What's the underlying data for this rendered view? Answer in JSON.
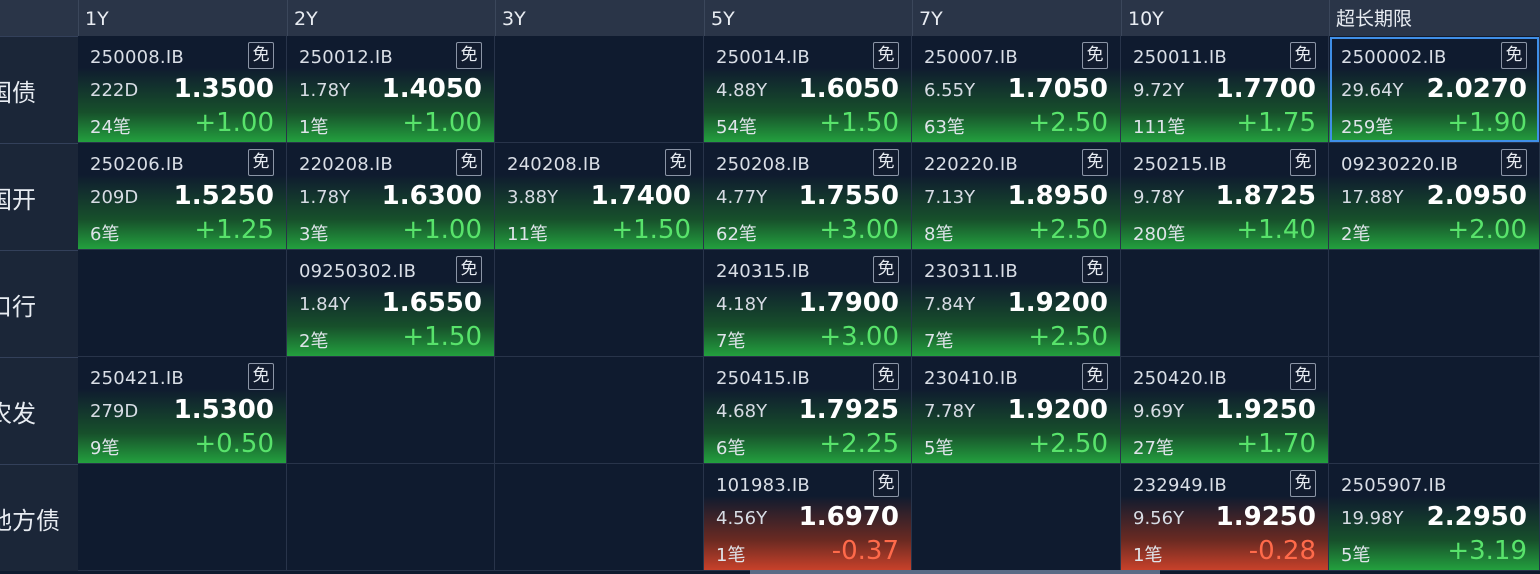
{
  "columns": [
    "1Y",
    "2Y",
    "3Y",
    "5Y",
    "7Y",
    "10Y",
    "超长期限"
  ],
  "rows": [
    {
      "label": "国债",
      "cells": [
        {
          "code": "250008.IB",
          "badge": "免",
          "term": "222D",
          "yield": "1.3500",
          "count": "24笔",
          "change": "+1.00",
          "trend": "up"
        },
        {
          "code": "250012.IB",
          "badge": "免",
          "term": "1.78Y",
          "yield": "1.4050",
          "count": "1笔",
          "change": "+1.00",
          "trend": "up"
        },
        null,
        {
          "code": "250014.IB",
          "badge": "免",
          "term": "4.88Y",
          "yield": "1.6050",
          "count": "54笔",
          "change": "+1.50",
          "trend": "up"
        },
        {
          "code": "250007.IB",
          "badge": "免",
          "term": "6.55Y",
          "yield": "1.7050",
          "count": "63笔",
          "change": "+2.50",
          "trend": "up"
        },
        {
          "code": "250011.IB",
          "badge": "免",
          "term": "9.72Y",
          "yield": "1.7700",
          "count": "111笔",
          "change": "+1.75",
          "trend": "up"
        },
        {
          "code": "2500002.IB",
          "badge": "免",
          "term": "29.64Y",
          "yield": "2.0270",
          "count": "259笔",
          "change": "+1.90",
          "trend": "up",
          "selected": true
        }
      ]
    },
    {
      "label": "国开",
      "cells": [
        {
          "code": "250206.IB",
          "badge": "免",
          "term": "209D",
          "yield": "1.5250",
          "count": "6笔",
          "change": "+1.25",
          "trend": "up"
        },
        {
          "code": "220208.IB",
          "badge": "免",
          "term": "1.78Y",
          "yield": "1.6300",
          "count": "3笔",
          "change": "+1.00",
          "trend": "up"
        },
        {
          "code": "240208.IB",
          "badge": "免",
          "term": "3.88Y",
          "yield": "1.7400",
          "count": "11笔",
          "change": "+1.50",
          "trend": "up"
        },
        {
          "code": "250208.IB",
          "badge": "免",
          "term": "4.77Y",
          "yield": "1.7550",
          "count": "62笔",
          "change": "+3.00",
          "trend": "up"
        },
        {
          "code": "220220.IB",
          "badge": "免",
          "term": "7.13Y",
          "yield": "1.8950",
          "count": "8笔",
          "change": "+2.50",
          "trend": "up"
        },
        {
          "code": "250215.IB",
          "badge": "免",
          "term": "9.78Y",
          "yield": "1.8725",
          "count": "280笔",
          "change": "+1.40",
          "trend": "up"
        },
        {
          "code": "09230220.IB",
          "badge": "免",
          "term": "17.88Y",
          "yield": "2.0950",
          "count": "2笔",
          "change": "+2.00",
          "trend": "up"
        }
      ]
    },
    {
      "label": "口行",
      "cells": [
        null,
        {
          "code": "09250302.IB",
          "badge": "免",
          "term": "1.84Y",
          "yield": "1.6550",
          "count": "2笔",
          "change": "+1.50",
          "trend": "up"
        },
        null,
        {
          "code": "240315.IB",
          "badge": "免",
          "term": "4.18Y",
          "yield": "1.7900",
          "count": "7笔",
          "change": "+3.00",
          "trend": "up"
        },
        {
          "code": "230311.IB",
          "badge": "免",
          "term": "7.84Y",
          "yield": "1.9200",
          "count": "7笔",
          "change": "+2.50",
          "trend": "up"
        },
        null,
        null
      ]
    },
    {
      "label": "农发",
      "cells": [
        {
          "code": "250421.IB",
          "badge": "免",
          "term": "279D",
          "yield": "1.5300",
          "count": "9笔",
          "change": "+0.50",
          "trend": "up"
        },
        null,
        null,
        {
          "code": "250415.IB",
          "badge": "免",
          "term": "4.68Y",
          "yield": "1.7925",
          "count": "6笔",
          "change": "+2.25",
          "trend": "up"
        },
        {
          "code": "230410.IB",
          "badge": "免",
          "term": "7.78Y",
          "yield": "1.9200",
          "count": "5笔",
          "change": "+2.50",
          "trend": "up"
        },
        {
          "code": "250420.IB",
          "badge": "免",
          "term": "9.69Y",
          "yield": "1.9250",
          "count": "27笔",
          "change": "+1.70",
          "trend": "up"
        },
        null
      ]
    },
    {
      "label": "地方债",
      "cells": [
        null,
        null,
        null,
        {
          "code": "101983.IB",
          "badge": "免",
          "term": "4.56Y",
          "yield": "1.6970",
          "count": "1笔",
          "change": "-0.37",
          "trend": "down"
        },
        null,
        {
          "code": "232949.IB",
          "badge": "免",
          "term": "9.56Y",
          "yield": "1.9250",
          "count": "1笔",
          "change": "-0.28",
          "trend": "down"
        },
        {
          "code": "2505907.IB",
          "badge": "",
          "term": "19.98Y",
          "yield": "2.2950",
          "count": "5笔",
          "change": "+3.19",
          "trend": "up"
        }
      ]
    }
  ],
  "colors": {
    "up": "#58e36b",
    "down": "#ff6a4a",
    "selection": "#3f8fe8",
    "header_bg": "#2a3548",
    "cell_bg": "#0f1b2f"
  }
}
